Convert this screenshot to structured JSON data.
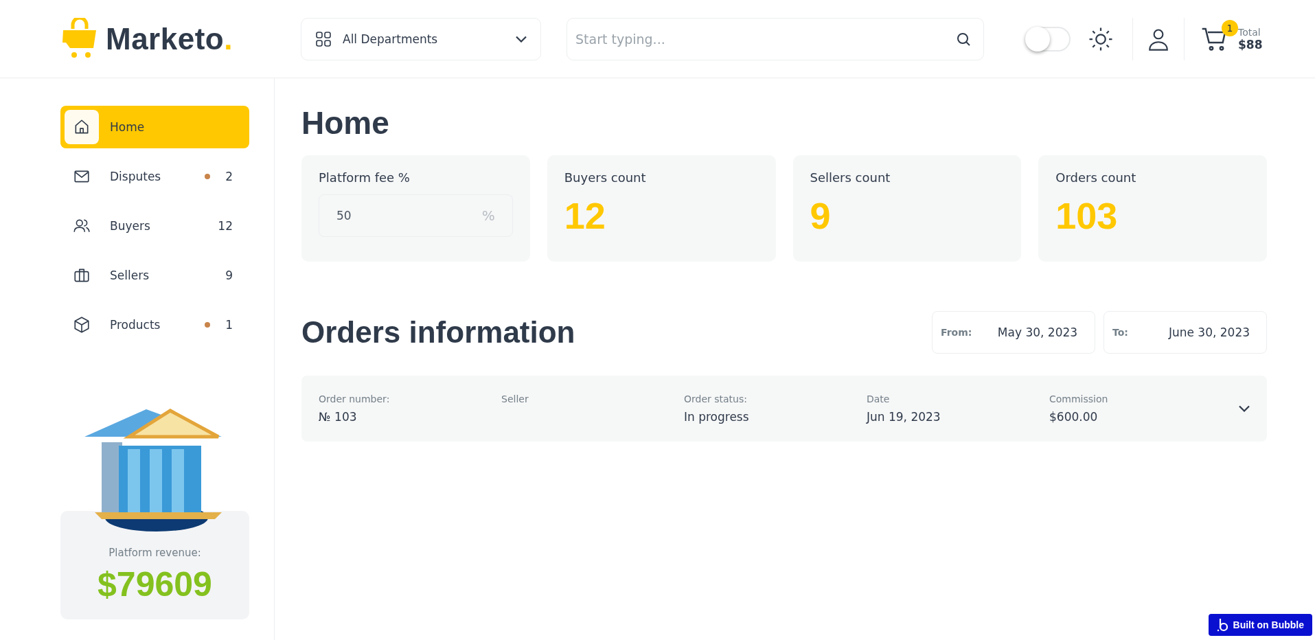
{
  "header": {
    "logo": "Marketo",
    "logo_dot": ".",
    "departments": "All Departments",
    "search": {
      "placeholder": "Start typing..."
    },
    "theme_toggle": {
      "on": false
    },
    "cart": {
      "count": "1",
      "label": "Total",
      "total": "$88"
    }
  },
  "sidebar": {
    "items": [
      {
        "label": "Home",
        "selected": true,
        "dot": false
      },
      {
        "label": "Disputes",
        "selected": false,
        "dot": true,
        "count": "2"
      },
      {
        "label": "Buyers",
        "selected": false,
        "dot": false,
        "count": "12"
      },
      {
        "label": "Sellers",
        "selected": false,
        "dot": false,
        "count": "9"
      },
      {
        "label": "Products",
        "selected": false,
        "dot": true,
        "count": "1"
      }
    ],
    "revenue": {
      "label": "Platform revenue:",
      "value": "$79609"
    }
  },
  "main": {
    "title": "Home",
    "stats": [
      {
        "kind": "input",
        "label": "Platform fee %",
        "value": "50",
        "unit": "%"
      },
      {
        "kind": "count",
        "label": "Buyers count",
        "value": "12"
      },
      {
        "kind": "count",
        "label": "Sellers count",
        "value": "9"
      },
      {
        "kind": "count",
        "label": "Orders count",
        "value": "103"
      }
    ],
    "orders_title": "Orders information",
    "date_from": {
      "label": "From:",
      "value": "May 30, 2023"
    },
    "date_to": {
      "label": "To:",
      "value": "June 30, 2023"
    },
    "orders": [
      {
        "fields": [
          {
            "label": "Order number:",
            "value": "№ 103"
          },
          {
            "label": "Seller"
          },
          {
            "label": "Order status:",
            "value": "In progress"
          },
          {
            "label": "Date",
            "value": "Jun 19, 2023"
          },
          {
            "label": "Commission",
            "value": "$600.00"
          }
        ],
        "expanded": false
      }
    ]
  },
  "badge": "Built on Bubble"
}
